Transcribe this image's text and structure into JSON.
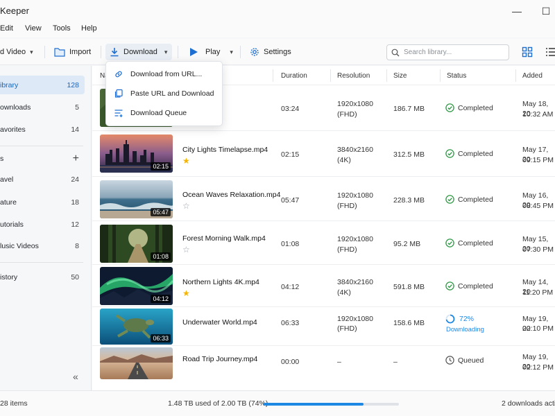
{
  "window": {
    "title": "Keeper",
    "minimize_glyph": "—",
    "maximize_glyph": "☐"
  },
  "menu": [
    "Edit",
    "View",
    "Tools",
    "Help"
  ],
  "toolbar": {
    "add_video": "d Video",
    "import": "Import",
    "download": "Download",
    "play": "Play",
    "settings": "Settings",
    "search_placeholder": "Search library..."
  },
  "download_menu": [
    {
      "label": "Download from URL...",
      "icon": "link-icon"
    },
    {
      "label": "Paste URL and Download",
      "icon": "paste-icon"
    },
    {
      "label": "Download Queue",
      "icon": "queue-icon"
    }
  ],
  "sidebar": {
    "items": [
      {
        "label": "ibrary",
        "count": "128",
        "selected": true
      },
      {
        "label": "ownloads",
        "count": "5"
      },
      {
        "label": "avorites",
        "count": "14"
      }
    ],
    "section_label": "s",
    "playlists": [
      {
        "label": "avel",
        "count": "24"
      },
      {
        "label": "ature",
        "count": "18"
      },
      {
        "label": "utorials",
        "count": "12"
      },
      {
        "label": "lusic Videos",
        "count": "8"
      }
    ],
    "history": {
      "label": "istory",
      "count": "50"
    },
    "collapse_glyph": "«"
  },
  "table": {
    "columns": [
      "Na",
      "Duration",
      "Resolution",
      "Size",
      "Status",
      "Added"
    ],
    "rows": [
      {
        "name": "",
        "duration": "03:24",
        "res1": "1920x1080",
        "res2": "(FHD)",
        "size": "186.7 MB",
        "status": "Completed",
        "date": "May 18, 20",
        "time": "10:32 AM",
        "thumb": "green",
        "badge": ""
      },
      {
        "name": "City Lights Timelapse.mp4",
        "starred": true,
        "duration": "02:15",
        "res1": "3840x2160",
        "res2": "(4K)",
        "size": "312.5 MB",
        "status": "Completed",
        "date": "May 17, 20",
        "time": "09:15 PM",
        "thumb": "city",
        "badge": "02:15"
      },
      {
        "name": "Ocean Waves Relaxation.mp4",
        "starred": false,
        "duration": "05:47",
        "res1": "1920x1080",
        "res2": "(FHD)",
        "size": "228.3 MB",
        "status": "Completed",
        "date": "May 16, 20",
        "time": "08:45 PM",
        "thumb": "ocean",
        "badge": "05:47"
      },
      {
        "name": "Forest Morning Walk.mp4",
        "starred": false,
        "duration": "01:08",
        "res1": "1920x1080",
        "res2": "(FHD)",
        "size": "95.2 MB",
        "status": "Completed",
        "date": "May 15, 20",
        "time": "07:30 PM",
        "thumb": "forest",
        "badge": "01:08"
      },
      {
        "name": "Northern Lights 4K.mp4",
        "starred": true,
        "duration": "04:12",
        "res1": "3840x2160",
        "res2": "(4K)",
        "size": "591.8 MB",
        "status": "Completed",
        "date": "May 14, 20",
        "time": "11:20 PM",
        "thumb": "aurora",
        "badge": "04:12"
      },
      {
        "name": "Underwater World.mp4",
        "duration": "06:33",
        "res1": "1920x1080",
        "res2": "(FHD)",
        "size": "158.6 MB",
        "status": "72%",
        "status_sub": "Downloading",
        "progress": 0.72,
        "date": "May 19, 20",
        "time": "02:10 PM",
        "thumb": "turtle",
        "badge": "06:33"
      },
      {
        "name": "Road Trip Journey.mp4",
        "duration": "00:00",
        "res1": "–",
        "res2": "",
        "size": "–",
        "status": "Queued",
        "date": "May 19, 20",
        "time": "02:12 PM",
        "thumb": "road",
        "badge": ""
      }
    ]
  },
  "statusbar": {
    "items": "28 items",
    "storage": "1.48 TB used of 2.00 TB (74%)",
    "storage_fraction": 0.74,
    "downloads": "2 downloads activ"
  },
  "colors": {
    "accent": "#1e88e5",
    "success": "#2e9a45",
    "star": "#f5b400"
  }
}
